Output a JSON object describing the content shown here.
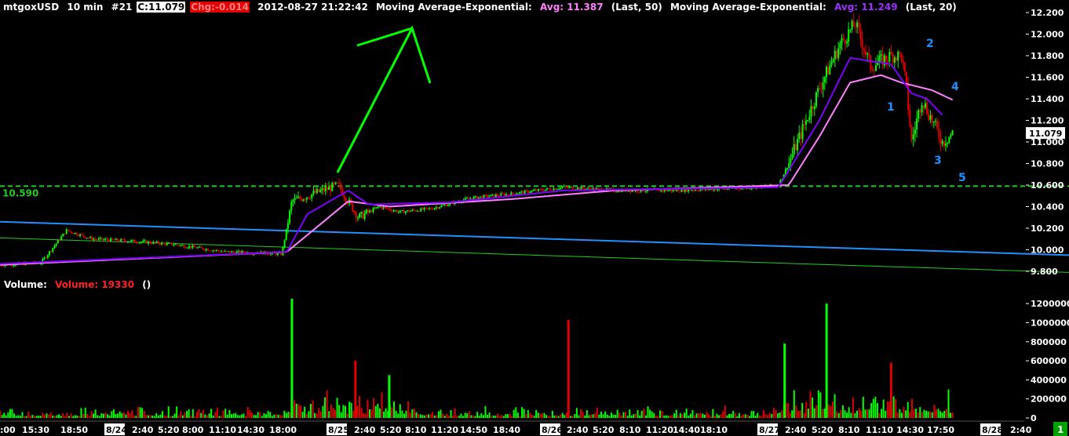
{
  "header": {
    "symbol": "mtgoxUSD",
    "interval": "10 min",
    "bar_index": "#21",
    "close_label": "C:11.079",
    "change_label": "Chg:-0.014",
    "datetime": "2012-08-27 21:22:42",
    "ma1_name": "Moving Average-Exponential:",
    "ma1_avg": "Avg: 11.387",
    "ma1_params": "(Last, 50)",
    "ma2_name": "Moving Average-Exponential:",
    "ma2_avg": "Avg: 11.249",
    "ma2_params": "(Last, 20)"
  },
  "volume_header": {
    "label": "Volume:",
    "value_label": "Volume: 19330",
    "extra": "()"
  },
  "colors": {
    "background": "#000000",
    "up_bar": "#00ff00",
    "down_bar": "#e00000",
    "ema50": "#ff80ff",
    "ema20": "#8000ff",
    "support_line": "#22cc22",
    "blue_trend": "#1e90ff",
    "green_trend": "#22cc22",
    "annotation": "#1e90ff",
    "last_price_box": "#ffffff"
  },
  "chart_data": [
    {
      "type": "candlestick",
      "ylim": [
        9.72,
        12.25
      ],
      "y_ticks": [
        "12.200",
        "12.000",
        "11.800",
        "11.600",
        "11.400",
        "11.200",
        "11.000",
        "10.800",
        "10.600",
        "10.400",
        "10.200",
        "10.000",
        "9.800"
      ],
      "last_price_label": "11.079",
      "last_price": 11.079,
      "support_level_label": "10.590",
      "support_level": 10.59,
      "price_path": [
        [
          0,
          9.86
        ],
        [
          0.04,
          9.88
        ],
        [
          0.065,
          10.18
        ],
        [
          0.09,
          10.1
        ],
        [
          0.13,
          10.08
        ],
        [
          0.17,
          10.05
        ],
        [
          0.22,
          9.98
        ],
        [
          0.26,
          9.97
        ],
        [
          0.275,
          9.96
        ],
        [
          0.285,
          10.45
        ],
        [
          0.3,
          10.5
        ],
        [
          0.33,
          10.6
        ],
        [
          0.35,
          10.3
        ],
        [
          0.37,
          10.4
        ],
        [
          0.39,
          10.35
        ],
        [
          0.42,
          10.38
        ],
        [
          0.46,
          10.48
        ],
        [
          0.5,
          10.52
        ],
        [
          0.55,
          10.58
        ],
        [
          0.6,
          10.55
        ],
        [
          0.66,
          10.55
        ],
        [
          0.72,
          10.57
        ],
        [
          0.76,
          10.6
        ],
        [
          0.77,
          10.8
        ],
        [
          0.8,
          11.5
        ],
        [
          0.82,
          11.9
        ],
        [
          0.835,
          12.1
        ],
        [
          0.85,
          11.7
        ],
        [
          0.87,
          11.8
        ],
        [
          0.88,
          11.8
        ],
        [
          0.885,
          11.5
        ],
        [
          0.89,
          11.0
        ],
        [
          0.9,
          11.4
        ],
        [
          0.92,
          11.0
        ],
        [
          0.93,
          11.08
        ]
      ],
      "ema20_path": [
        [
          0,
          9.87
        ],
        [
          0.28,
          9.98
        ],
        [
          0.3,
          10.33
        ],
        [
          0.34,
          10.55
        ],
        [
          0.36,
          10.42
        ],
        [
          0.44,
          10.44
        ],
        [
          0.55,
          10.55
        ],
        [
          0.76,
          10.58
        ],
        [
          0.8,
          11.2
        ],
        [
          0.83,
          11.78
        ],
        [
          0.85,
          11.75
        ],
        [
          0.87,
          11.72
        ],
        [
          0.89,
          11.45
        ],
        [
          0.905,
          11.4
        ],
        [
          0.92,
          11.25
        ]
      ],
      "ema50_path": [
        [
          0,
          9.86
        ],
        [
          0.28,
          9.98
        ],
        [
          0.34,
          10.45
        ],
        [
          0.38,
          10.4
        ],
        [
          0.5,
          10.47
        ],
        [
          0.6,
          10.55
        ],
        [
          0.77,
          10.6
        ],
        [
          0.8,
          11.05
        ],
        [
          0.83,
          11.55
        ],
        [
          0.86,
          11.62
        ],
        [
          0.88,
          11.55
        ],
        [
          0.91,
          11.48
        ],
        [
          0.93,
          11.39
        ]
      ],
      "x_ticks": [
        ":00",
        "15:30",
        "18:50",
        "8/24",
        "2:40",
        "5:20",
        "8:00",
        "11:10",
        "14:30",
        "18:00",
        "8/25",
        "2:40",
        "5:20",
        "8:10",
        "11:20",
        "14:50",
        "18:40",
        "8/26",
        "2:40",
        "5:20",
        "8:10",
        "11:20",
        "14:40",
        "18:10",
        "8/27",
        "2:40",
        "5:20",
        "8:10",
        "11:10",
        "14:30",
        "17:50",
        "8/28",
        "2:40"
      ],
      "date_ticks": [
        "8/24",
        "8/25",
        "8/26",
        "8/27",
        "8/28"
      ],
      "wave_labels": [
        "1",
        "2",
        "3",
        "4",
        "5"
      ]
    },
    {
      "type": "bar",
      "title": "Volume",
      "value": 19330,
      "ylim": [
        0,
        1300000
      ],
      "y_ticks": [
        "1200000",
        "1000000",
        "800000",
        "600000",
        "400000",
        "200000",
        "0"
      ],
      "spikes": [
        {
          "x": 0.285,
          "value": 1250000,
          "dir": "up"
        },
        {
          "x": 0.347,
          "value": 600000,
          "dir": "down"
        },
        {
          "x": 0.38,
          "value": 450000,
          "dir": "up"
        },
        {
          "x": 0.555,
          "value": 1030000,
          "dir": "down"
        },
        {
          "x": 0.766,
          "value": 780000,
          "dir": "up"
        },
        {
          "x": 0.807,
          "value": 1200000,
          "dir": "up"
        },
        {
          "x": 0.87,
          "value": 580000,
          "dir": "down"
        }
      ]
    }
  ],
  "status": {
    "marker": "1"
  }
}
